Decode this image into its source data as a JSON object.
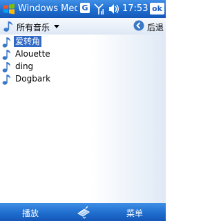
{
  "titlebar": {
    "app_title": "Windows Media",
    "network_badge": "G",
    "time": "17:53",
    "ok_label": "ok",
    "icons": [
      "windows-flag-icon",
      "signal-icon",
      "speaker-icon"
    ]
  },
  "header": {
    "library_label": "所有音乐",
    "back_label": "后退",
    "icons": [
      "music-note-icon",
      "chevron-down-icon",
      "back-arrow-icon"
    ]
  },
  "tracks": [
    {
      "title": "爱转角",
      "selected": true
    },
    {
      "title": "Alouette",
      "selected": false
    },
    {
      "title": "ding",
      "selected": false
    },
    {
      "title": "Dogbark",
      "selected": false
    }
  ],
  "softkeys": {
    "left": "播放",
    "right": "菜单",
    "center_icon": "keyboard-icon"
  },
  "colors": {
    "bar_blue": "#1f6ecf",
    "selection": "#316ac5"
  }
}
